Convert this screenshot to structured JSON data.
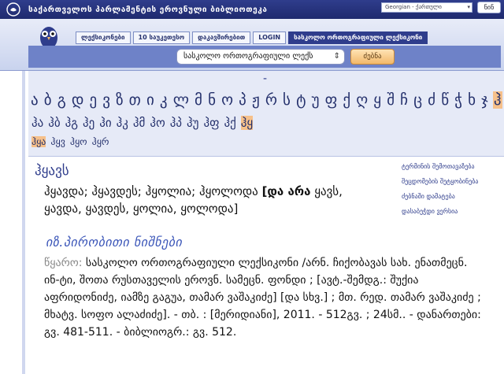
{
  "titlebar": {
    "title": "საქართველოს პარლამენტის ეროვნული ბიბლიოთეკა"
  },
  "header": {
    "language_select": "Georgian - ქართული",
    "help_button": "ნინ",
    "tabs": [
      {
        "label": "ლექსიკონები"
      },
      {
        "label": "10 საუკეთესო"
      },
      {
        "label": "დაკავშირებით"
      },
      {
        "label": "LOGIN"
      },
      {
        "label": "სასკოლო ორთოგრაფიული ლექსიკონი"
      }
    ]
  },
  "search": {
    "select_value": "სასკოლო ორთოგრაფიული ლექს",
    "button_label": "ძებნა"
  },
  "alphabet": {
    "dash": "-",
    "letters": [
      "ა",
      "ბ",
      "გ",
      "დ",
      "ე",
      "ვ",
      "ზ",
      "თ",
      "ი",
      "კ",
      "ლ",
      "მ",
      "ნ",
      "ო",
      "პ",
      "ჟ",
      "რ",
      "ს",
      "ტ",
      "უ",
      "ფ",
      "ქ",
      "ღ",
      "ყ",
      "შ",
      "ჩ",
      "ც",
      "ძ",
      "წ",
      "ჭ",
      "ხ",
      "ჯ",
      "ჰ"
    ],
    "selected_letter": "ჰ",
    "sub_items": [
      "ჰა",
      "ჰბ",
      "ჰგ",
      "ჰე",
      "ჰი",
      "ჰკ",
      "ჰმ",
      "ჰო",
      "ჰპ",
      "ჰუ",
      "ჰფ",
      "ჰქ",
      "ჰყ"
    ],
    "selected_sub": "ჰყ",
    "sub2_items": [
      "ჰყა",
      "ჰყვ",
      "ჰყო",
      "ჰყრ"
    ],
    "selected_sub2": "ჰყა"
  },
  "entry": {
    "headword": "ჰყავს",
    "forms_plain": "ჰყავდა; ჰყავდეს; ჰყოლია; ჰყოლოდა ",
    "forms_bold": "[და არა",
    "forms_rest": "ყავს, ყავდა, ყავდეს, ყოლია, ყოლოდა]",
    "abbr_heading": "იზ.პირობითი ნიშნები",
    "source_label": "წყარო:",
    "source_text": "სასკოლო ორთოგრაფიული ლექსიკონი /არნ. ჩიქობავას სახ. ენათმეცნ. ინ-ტი, შოთა რუსთაველის ეროვნ. სამეცნ. ფონდი ; [ავტ.-შემდგ.: შუქია აფრიდონიძე, იამზე გაგუა, თამარ ვაშაკიძე] [და სხვ.] ; მთ. რედ. თამარ ვაშაკიძე ; მხატვ. სოფო ალაძიძე]. - თბ. : [მერიდიანი], 2011. - 512გვ. ; 24სმ.. - დანართები: გვ. 481-511. - ბიბლიოგრ.: გვ. 512."
  },
  "sidebar": {
    "links": [
      {
        "label": "ტერმინის შემოთავაზება"
      },
      {
        "label": "შეცდომების შეტყობინება"
      },
      {
        "label": "ძებნაში დამატება"
      },
      {
        "label": "დასაბეჭდი ვერსია"
      }
    ]
  },
  "colors": {
    "primary": "#2f3d8c",
    "accent": "#f6c08a",
    "search_bar": "#6e82c8"
  }
}
